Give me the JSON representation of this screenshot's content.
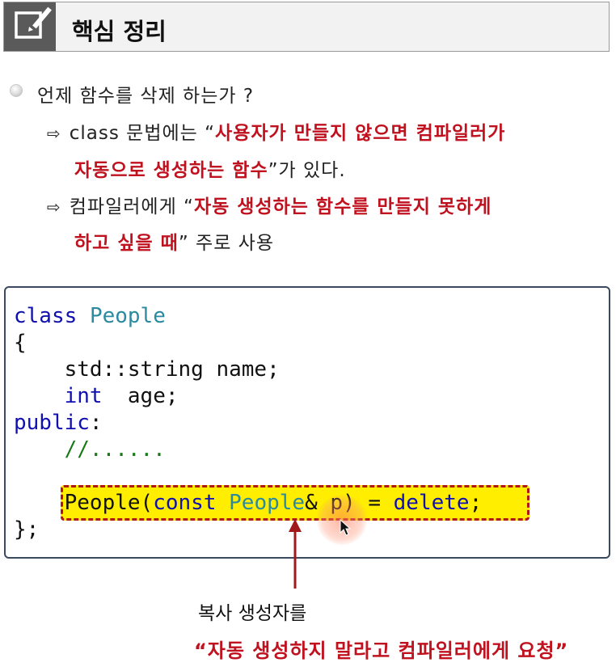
{
  "header": {
    "title": "핵심 정리",
    "icon": "edit-icon"
  },
  "bullet": {
    "text": "언제 함수를 삭제 하는가 ?"
  },
  "sub1": {
    "arrow": "⇨",
    "prefix": "class 문법에는 “",
    "red1": "사용자가 만들지 않으면 컴파일러가",
    "red2": "자동으로 생성하는 함수",
    "suffix": "”가 있다."
  },
  "sub2": {
    "arrow": "⇨",
    "prefix": "컴파일러에게 “",
    "red1": "자동 생성하는 함수를 만들지 못하게",
    "red2": "하고 싶을 때",
    "suffix": "” 주로 사용"
  },
  "code": {
    "l1_kw": "class",
    "l1_type": "People",
    "l2": "{",
    "l3": "    std::string name;",
    "l4_kw": "int",
    "l4_rest": "  age;",
    "l5_kw": "public",
    "l5_rest": ":",
    "l6": "    //......",
    "l7_a": "People(",
    "l7_kw1": "const",
    "l7_type": "People",
    "l7_b": "& p) = ",
    "l7_kw2": "delete",
    "l7_c": ";",
    "l8": "};"
  },
  "caption": {
    "line1": "복사 생성자를",
    "line2": "“자동 생성하지 말라고 컴파일러에게 요청”"
  },
  "colors": {
    "accent_red": "#c0111f",
    "keyword": "#1010b0",
    "type": "#2b8aa0",
    "comment": "#1a7a1a",
    "highlight": "#ffee00"
  }
}
